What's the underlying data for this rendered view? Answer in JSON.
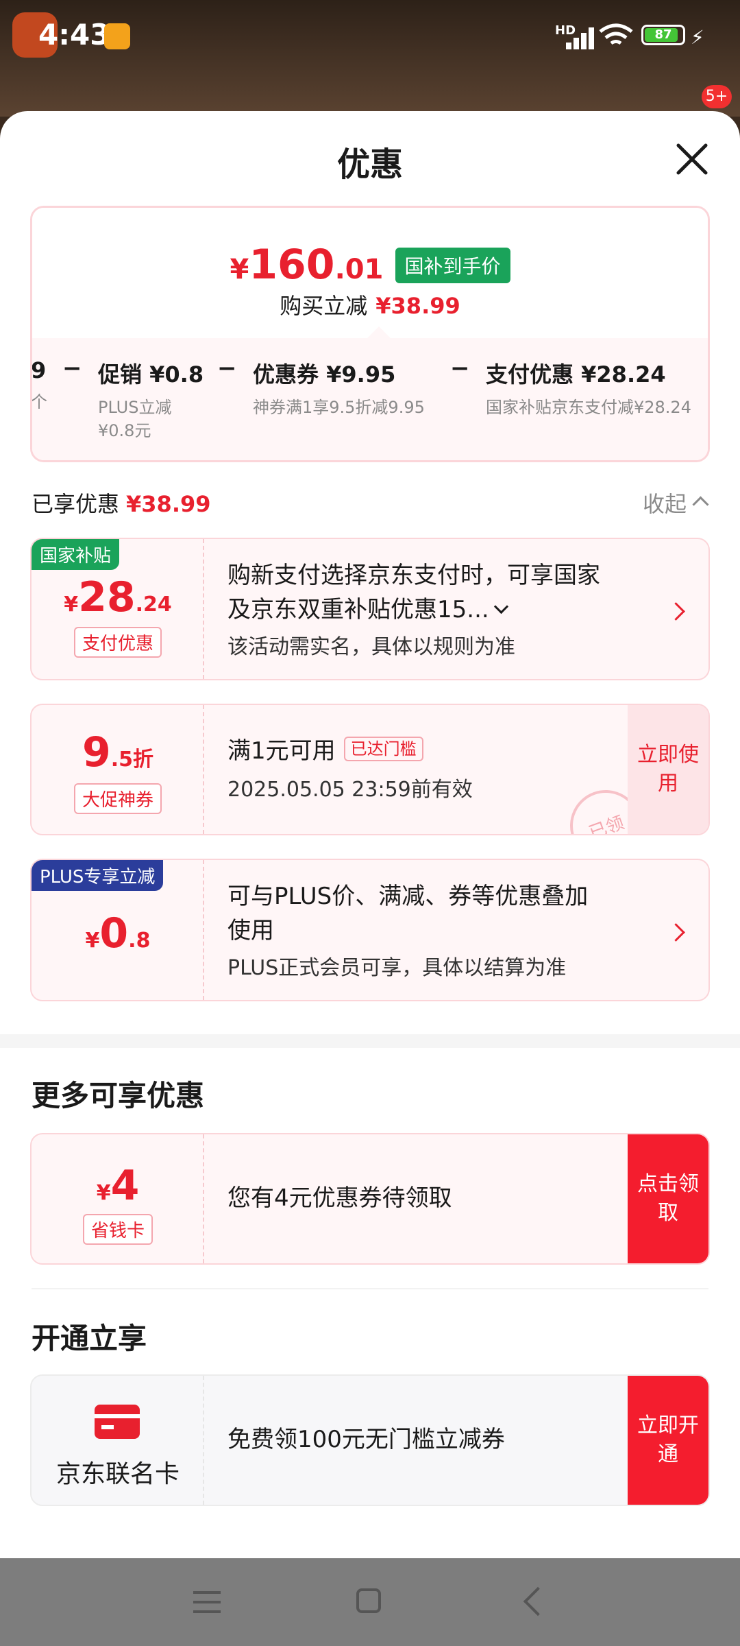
{
  "status_bar": {
    "time": "4:43",
    "network": "HD",
    "battery": "87",
    "notification_count": "5+"
  },
  "sheet": {
    "title": "优惠"
  },
  "summary": {
    "price_symbol": "¥",
    "price_int": "160",
    "price_dec": ".01",
    "price_tag": "国补到手价",
    "reduce_label": "购买立减",
    "reduce_amount": "¥38.99",
    "breakdown": [
      {
        "label": "9",
        "sub": "个"
      },
      {
        "label": "促销 ¥0.8",
        "sub1": "PLUS立减",
        "sub2": "¥0.8元"
      },
      {
        "label": "优惠券 ¥9.95",
        "sub": "神券满1享9.5折减9.95"
      },
      {
        "label": "支付优惠 ¥28.24",
        "sub": "国家补贴京东支付减¥28.24"
      }
    ],
    "minus": "−"
  },
  "enjoyed": {
    "label": "已享优惠",
    "amount": "¥38.99",
    "collapse": "收起"
  },
  "offers": [
    {
      "ribbon": "国家补贴",
      "ribbon_color": "#1aa35a",
      "sym": "¥",
      "big": "28",
      "dec": ".24",
      "tag": "支付优惠",
      "line1": "购新支付选择京东支付时，可享国家",
      "line2": "及京东双重补贴优惠15...",
      "sub": "该活动需实名，具体以规则为准"
    },
    {
      "big": "9",
      "dec": ".5折",
      "tag": "大促神券",
      "title": "满1元可用",
      "badge": "已达门槛",
      "sub": "2025.05.05 23:59前有效",
      "cta": "立即使用",
      "stamp": "已领"
    },
    {
      "ribbon": "PLUS专享立减",
      "ribbon_color": "#2b3d9b",
      "sym": "¥",
      "big": "0",
      "dec": ".8",
      "line1": "可与PLUS价、满减、券等优惠叠加",
      "line2": "使用",
      "sub": "PLUS正式会员可享，具体以结算为准"
    }
  ],
  "more": {
    "title": "更多可享优惠",
    "card": {
      "sym": "¥",
      "big": "4",
      "tag": "省钱卡",
      "text": "您有4元优惠券待领取",
      "cta": "点击领取"
    }
  },
  "open": {
    "title": "开通立享",
    "card": {
      "name": "京东联名卡",
      "text": "免费领100元无门槛立减券",
      "cta": "立即开通"
    }
  },
  "colors": {
    "accent": "#e8202e",
    "green": "#1aa35a",
    "plus_blue": "#2b3d9b"
  }
}
